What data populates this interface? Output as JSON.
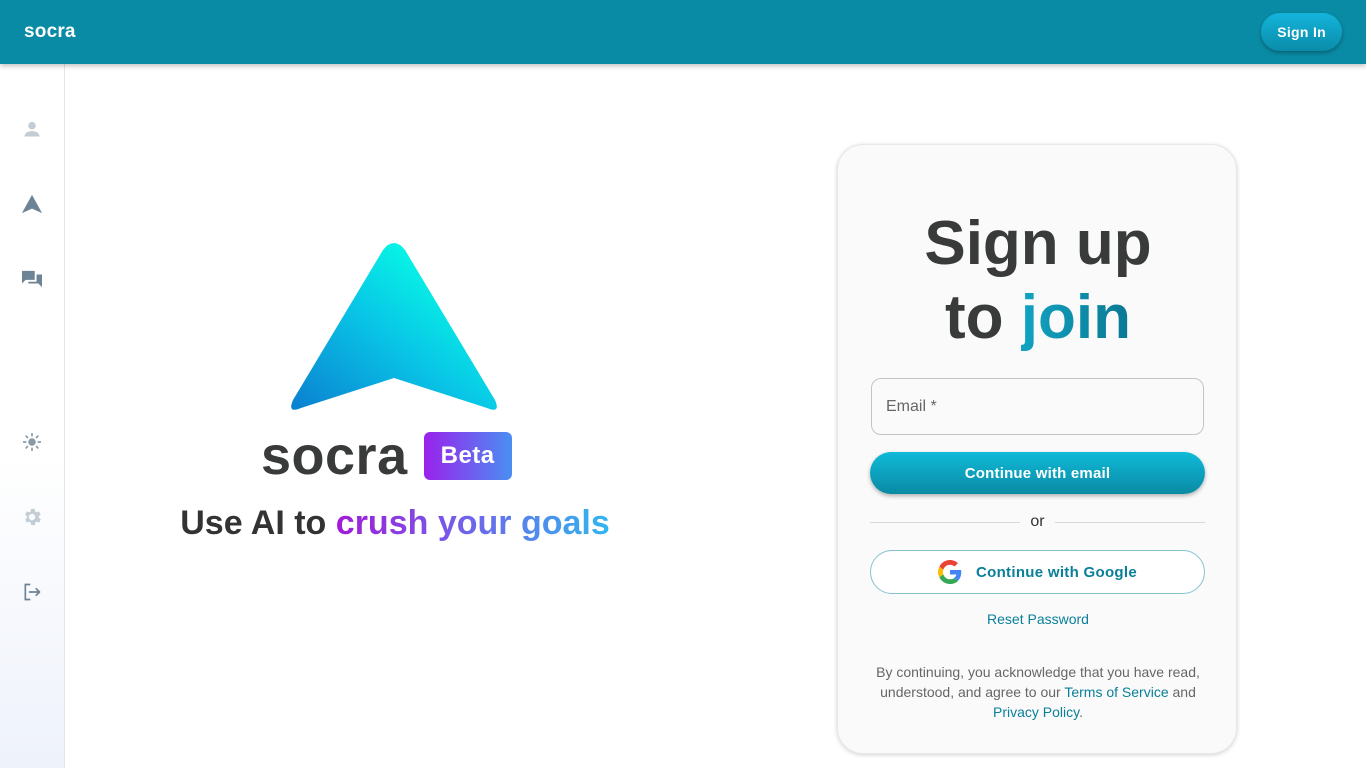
{
  "header": {
    "brand": "socra",
    "signin_label": "Sign In"
  },
  "sidebar": {
    "items": [
      {
        "icon": "person-icon"
      },
      {
        "icon": "navigation-arrow-icon"
      },
      {
        "icon": "chat-bubbles-icon"
      },
      {
        "icon": "sun-icon"
      },
      {
        "icon": "gear-icon"
      },
      {
        "icon": "logout-icon"
      }
    ]
  },
  "hero": {
    "logo_word": "socra",
    "beta_label": "Beta",
    "tagline_plain": "Use AI to ",
    "tagline_highlight": "crush your goals"
  },
  "signup": {
    "title_line1": "Sign up",
    "title_to": "to ",
    "title_join": "join",
    "email_placeholder": "Email *",
    "email_button": "Continue with email",
    "or_label": "or",
    "google_button": "Continue with Google",
    "reset_link": "Reset Password",
    "legal_prefix": "By continuing, you acknowledge that you have read, understood, and agree to our ",
    "terms_link": "Terms of Service",
    "legal_and": " and ",
    "privacy_link": "Privacy Policy",
    "legal_suffix": "."
  },
  "colors": {
    "primary": "#0a8ba5",
    "accent_purple": "#9a22ec",
    "accent_blue": "#2fb7f0",
    "text_dark": "#383b39"
  }
}
